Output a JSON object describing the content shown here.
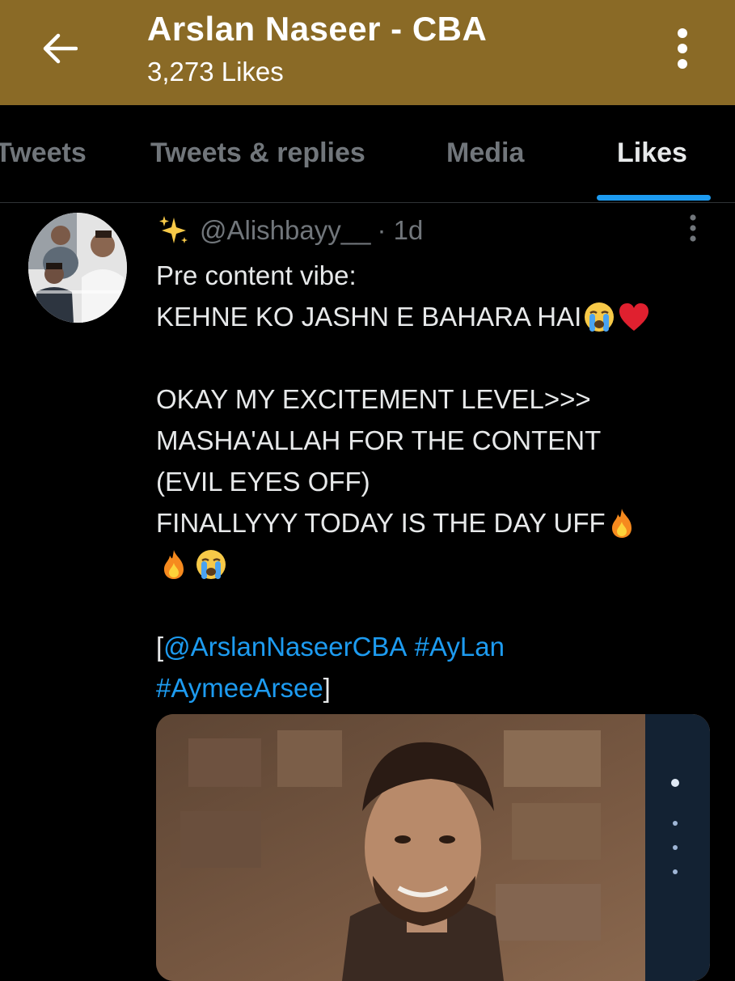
{
  "header": {
    "title": "Arslan Naseer - CBA",
    "subtitle": "3,273 Likes",
    "bg_color": "#8a6a26"
  },
  "tabs": [
    {
      "label": "Tweets",
      "active": false
    },
    {
      "label": "Tweets & replies",
      "active": false
    },
    {
      "label": "Media",
      "active": false
    },
    {
      "label": "Likes",
      "active": true
    }
  ],
  "accent": "#1d9bf0",
  "tweet": {
    "handle": "@Alishbayy__",
    "time": "· 1d",
    "lines": {
      "l1": "Pre content vibe:",
      "l2": "KEHNE KO JASHN E BAHARA HAI",
      "l3": "OKAY MY EXCITEMENT LEVEL>>>",
      "l4": "MASHA'ALLAH FOR THE CONTENT",
      "l5": "(EVIL EYES OFF)",
      "l6": "FINALLYYY TODAY IS THE DAY UFF",
      "l8_open": "[",
      "l8_mention": "@ArslanNaseerCBA",
      "l8_space": " ",
      "l8_tag1": "#AyLan",
      "l9_tag2": "#AymeeArsee",
      "l9_close": "]"
    },
    "icons": [
      "sparkles-icon",
      "crying-face-icon",
      "red-heart-icon",
      "fire-icon"
    ]
  }
}
